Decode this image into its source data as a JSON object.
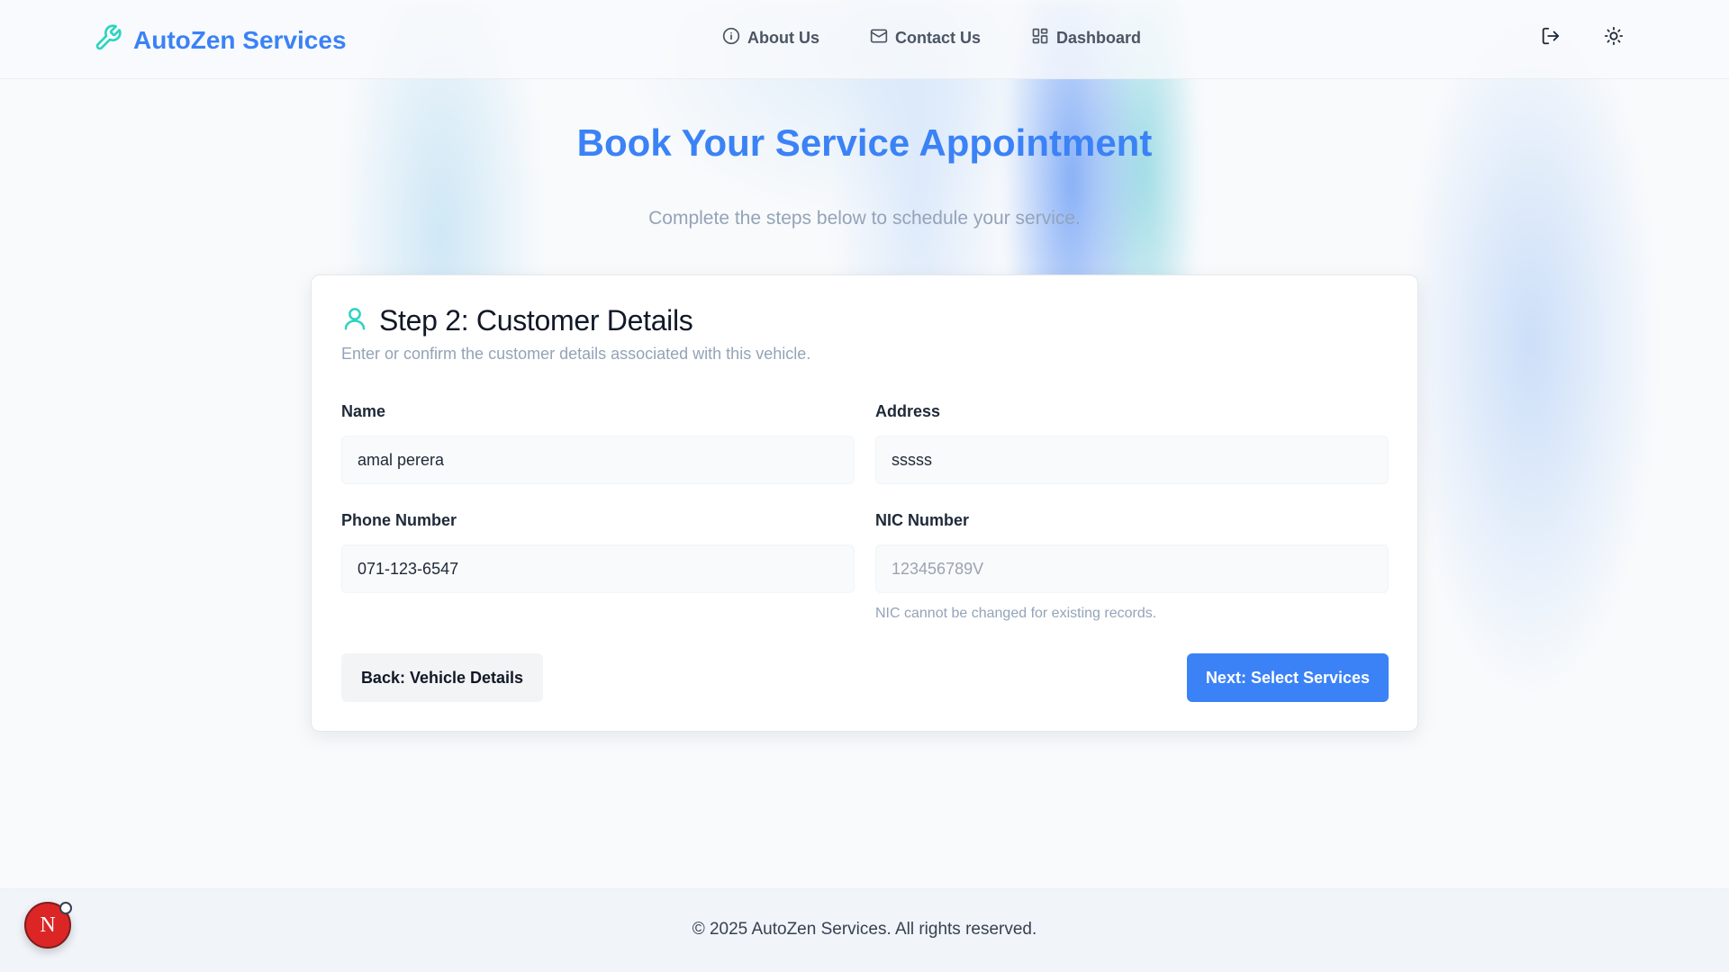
{
  "header": {
    "brand": "AutoZen Services",
    "nav": [
      {
        "label": "About Us",
        "icon": "info-icon"
      },
      {
        "label": "Contact Us",
        "icon": "mail-icon"
      },
      {
        "label": "Dashboard",
        "icon": "dashboard-grid-icon"
      }
    ],
    "actions": [
      "logout-icon",
      "sun-icon"
    ]
  },
  "page": {
    "title": "Book Your Service Appointment",
    "subtitle": "Complete the steps below to schedule your service."
  },
  "card": {
    "title": "Step 2: Customer Details",
    "description": "Enter or confirm the customer details associated with this vehicle.",
    "fields": {
      "name": {
        "label": "Name",
        "value": "amal perera"
      },
      "address": {
        "label": "Address",
        "value": "sssss"
      },
      "phone": {
        "label": "Phone Number",
        "value": "071-123-6547"
      },
      "nic": {
        "label": "NIC Number",
        "value": "123456789V",
        "hint": "NIC cannot be changed for existing records."
      }
    },
    "back_label": "Back: Vehicle Details",
    "next_label": "Next: Select Services"
  },
  "footer": {
    "text": "© 2025 AutoZen Services. All rights reserved."
  },
  "badge": {
    "letter": "N"
  },
  "colors": {
    "primary": "#3b82f6",
    "accent_teal": "#2dd4bf",
    "muted_text": "#94a3b8",
    "badge_red": "#dc2626"
  }
}
